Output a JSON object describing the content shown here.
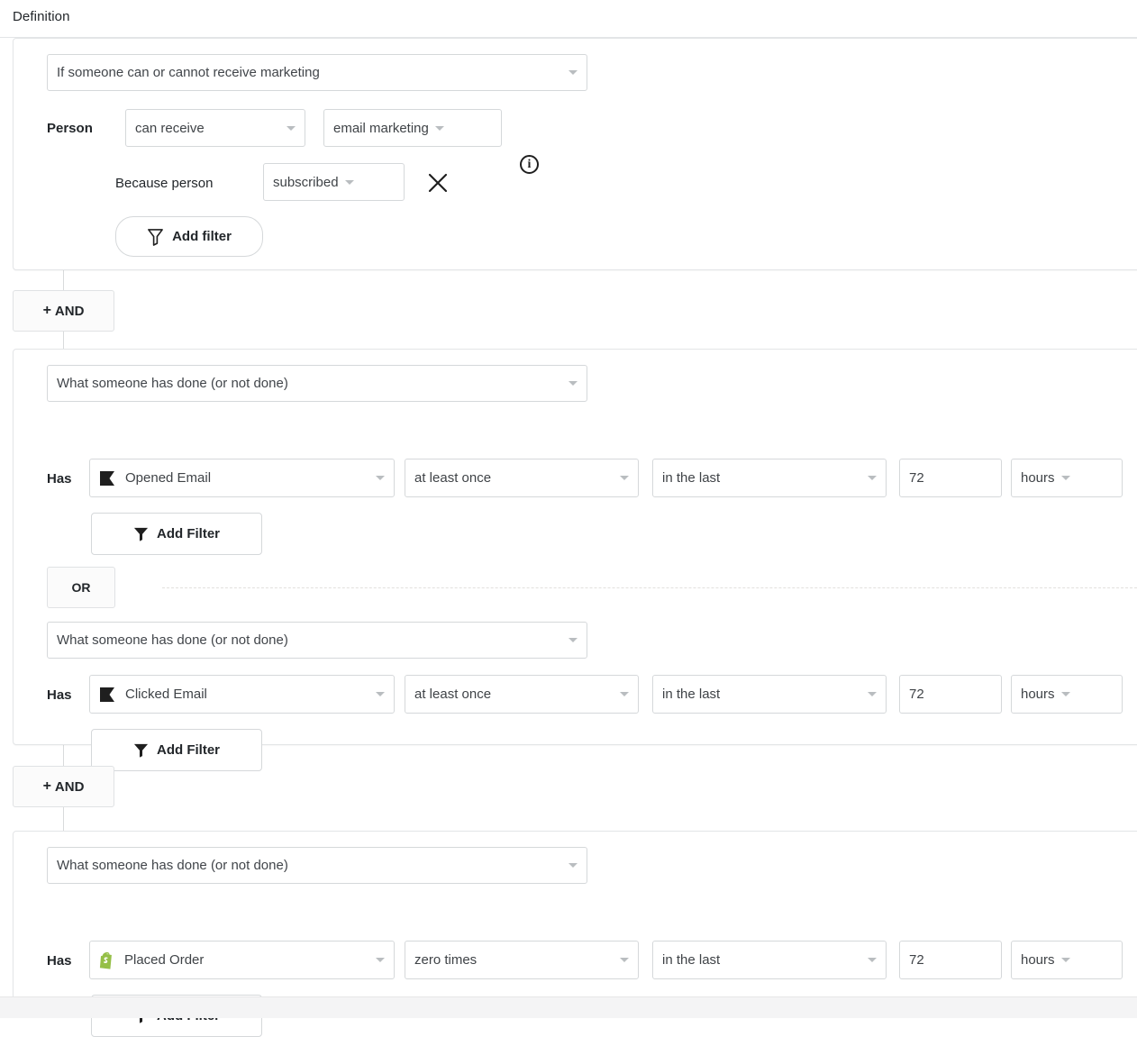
{
  "section": {
    "title": "Definition"
  },
  "blocks": [
    {
      "type_label": "If someone can or cannot receive marketing",
      "row_label": "Person",
      "ability": "can receive",
      "channel": "email marketing",
      "reason_label": "Because person",
      "reason": "subscribed",
      "add_filter_label": "Add filter",
      "info_icon": "info-icon",
      "remove_icon": "close-icon"
    },
    {
      "connector": "AND",
      "rows": [
        {
          "type_label": "What someone has done (or not done)",
          "row_label": "Has",
          "metric": "Opened Email",
          "metric_icon": "klaviyo-flag-icon",
          "frequency": "at least once",
          "timeframe": "in the last",
          "amount": "72",
          "unit": "hours",
          "add_filter_label": "Add Filter"
        },
        {
          "connector": "OR",
          "type_label": "What someone has done (or not done)",
          "row_label": "Has",
          "metric": "Clicked Email",
          "metric_icon": "klaviyo-flag-icon",
          "frequency": "at least once",
          "timeframe": "in the last",
          "amount": "72",
          "unit": "hours",
          "add_filter_label": "Add Filter"
        }
      ]
    },
    {
      "connector": "AND",
      "rows": [
        {
          "type_label": "What someone has done (or not done)",
          "row_label": "Has",
          "metric": "Placed Order",
          "metric_icon": "shopify-bag-icon",
          "frequency": "zero times",
          "timeframe": "in the last",
          "amount": "72",
          "unit": "hours",
          "add_filter_label": "Add Filter"
        }
      ]
    }
  ],
  "colors": {
    "border": "#d5d8da",
    "card_border": "#e3e5e7",
    "text": "#22262a",
    "muted": "#6b7075",
    "shopify_green": "#95bf47",
    "metric_black": "#1f1f1f"
  }
}
